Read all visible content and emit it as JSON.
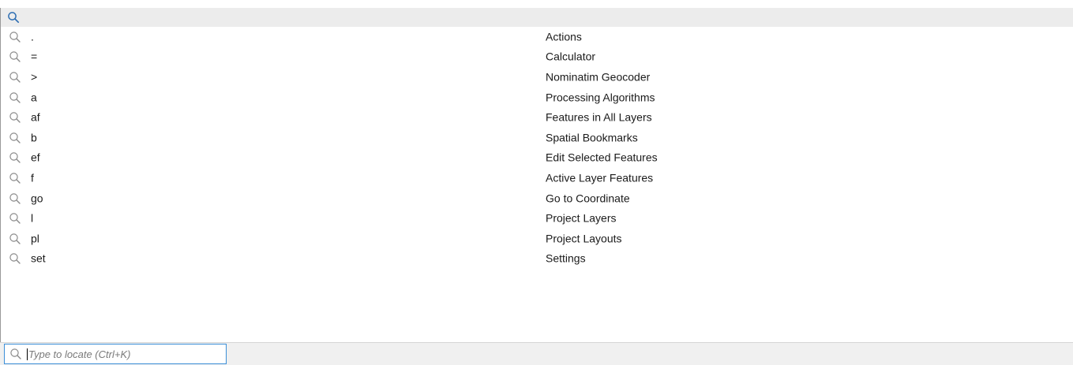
{
  "colors": {
    "accent": "#3c8fd8",
    "header_bg": "#ececec",
    "icon_gray": "#8a8a8a",
    "icon_blue": "#2f6fb3"
  },
  "header": {
    "icon": "search-icon"
  },
  "results": [
    {
      "prefix": ".",
      "name": "Actions",
      "icon": "search-icon"
    },
    {
      "prefix": "=",
      "name": "Calculator",
      "icon": "search-icon"
    },
    {
      "prefix": ">",
      "name": "Nominatim Geocoder",
      "icon": "search-icon"
    },
    {
      "prefix": "a",
      "name": "Processing Algorithms",
      "icon": "search-icon"
    },
    {
      "prefix": "af",
      "name": "Features in All Layers",
      "icon": "search-icon"
    },
    {
      "prefix": "b",
      "name": "Spatial Bookmarks",
      "icon": "search-icon"
    },
    {
      "prefix": "ef",
      "name": "Edit Selected Features",
      "icon": "search-icon"
    },
    {
      "prefix": "f",
      "name": "Active Layer Features",
      "icon": "search-icon"
    },
    {
      "prefix": "go",
      "name": "Go to Coordinate",
      "icon": "search-icon"
    },
    {
      "prefix": "l",
      "name": "Project Layers",
      "icon": "search-icon"
    },
    {
      "prefix": "pl",
      "name": "Project Layouts",
      "icon": "search-icon"
    },
    {
      "prefix": "set",
      "name": "Settings",
      "icon": "search-icon"
    }
  ],
  "locator": {
    "value": "",
    "placeholder": "Type to locate (Ctrl+K)",
    "icon": "search-icon"
  }
}
